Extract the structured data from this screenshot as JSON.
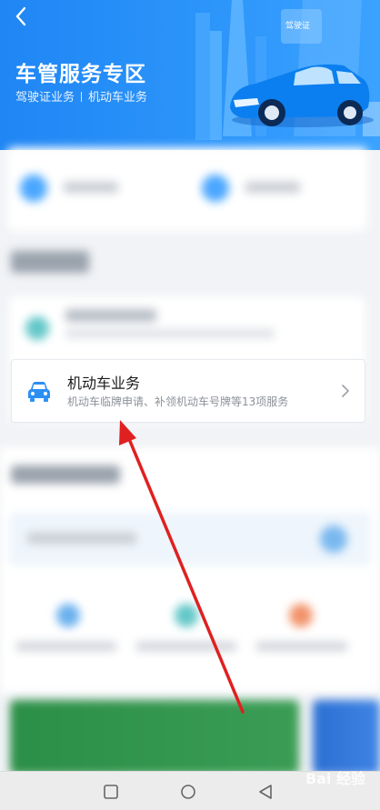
{
  "header": {
    "title": "车管服务专区",
    "subtitle_left": "驾驶证业务",
    "subtitle_right": "机动车业务",
    "building_label": "驾驶证"
  },
  "service_item": {
    "name": "机动车业务",
    "description": "机动车临牌申请、补领机动车号牌等13项服务",
    "icon": "car-icon"
  },
  "watermark": "Bai 经验",
  "colors": {
    "header_blue": "#1f86f4",
    "annotation_red": "#e02020",
    "icon_blue": "#2c8ff5"
  }
}
